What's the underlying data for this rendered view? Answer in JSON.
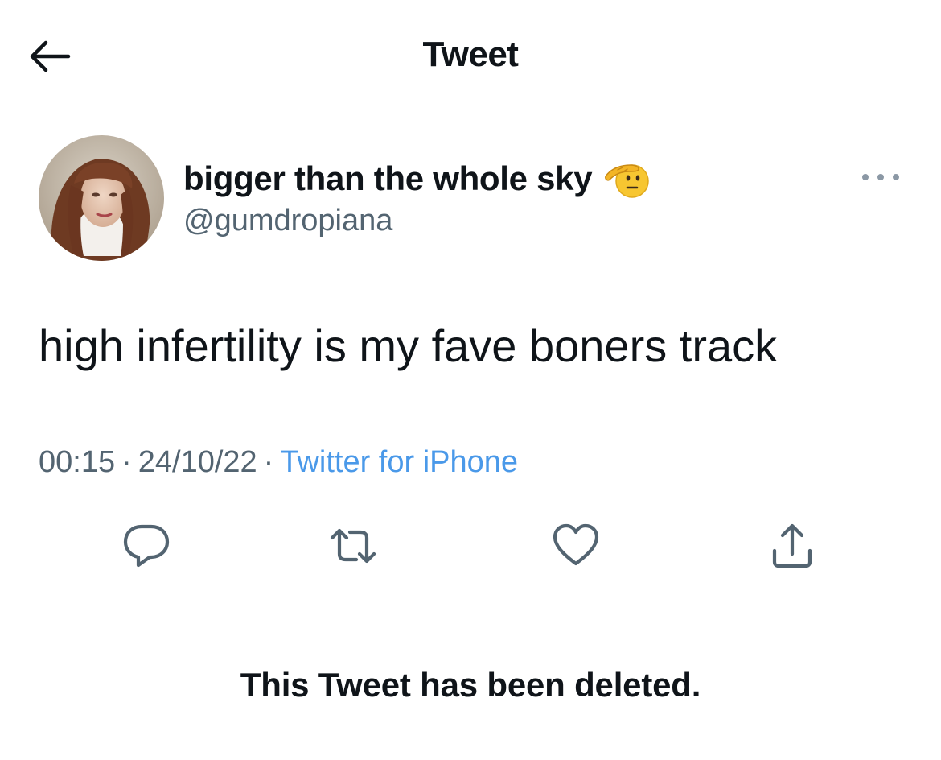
{
  "header": {
    "title": "Tweet",
    "back_icon": "arrow-left-icon"
  },
  "tweet": {
    "author": {
      "display_name": "bigger than the whole sky",
      "name_emoji": "saluting-face-emoji",
      "handle": "@gumdropiana"
    },
    "text": "high infertility is my fave boners track",
    "time": "00:15",
    "date": "24/10/22",
    "separator": "·",
    "source": "Twitter for iPhone",
    "more_icon": "more-horizontal-icon"
  },
  "actions": {
    "reply_icon": "reply-icon",
    "retweet_icon": "retweet-icon",
    "like_icon": "heart-icon",
    "share_icon": "share-icon"
  },
  "notice": {
    "deleted_text": "This Tweet has been deleted."
  },
  "colors": {
    "text_primary": "#0f1419",
    "text_secondary": "#536471",
    "link": "#4a99e9",
    "icon": "#536471"
  }
}
